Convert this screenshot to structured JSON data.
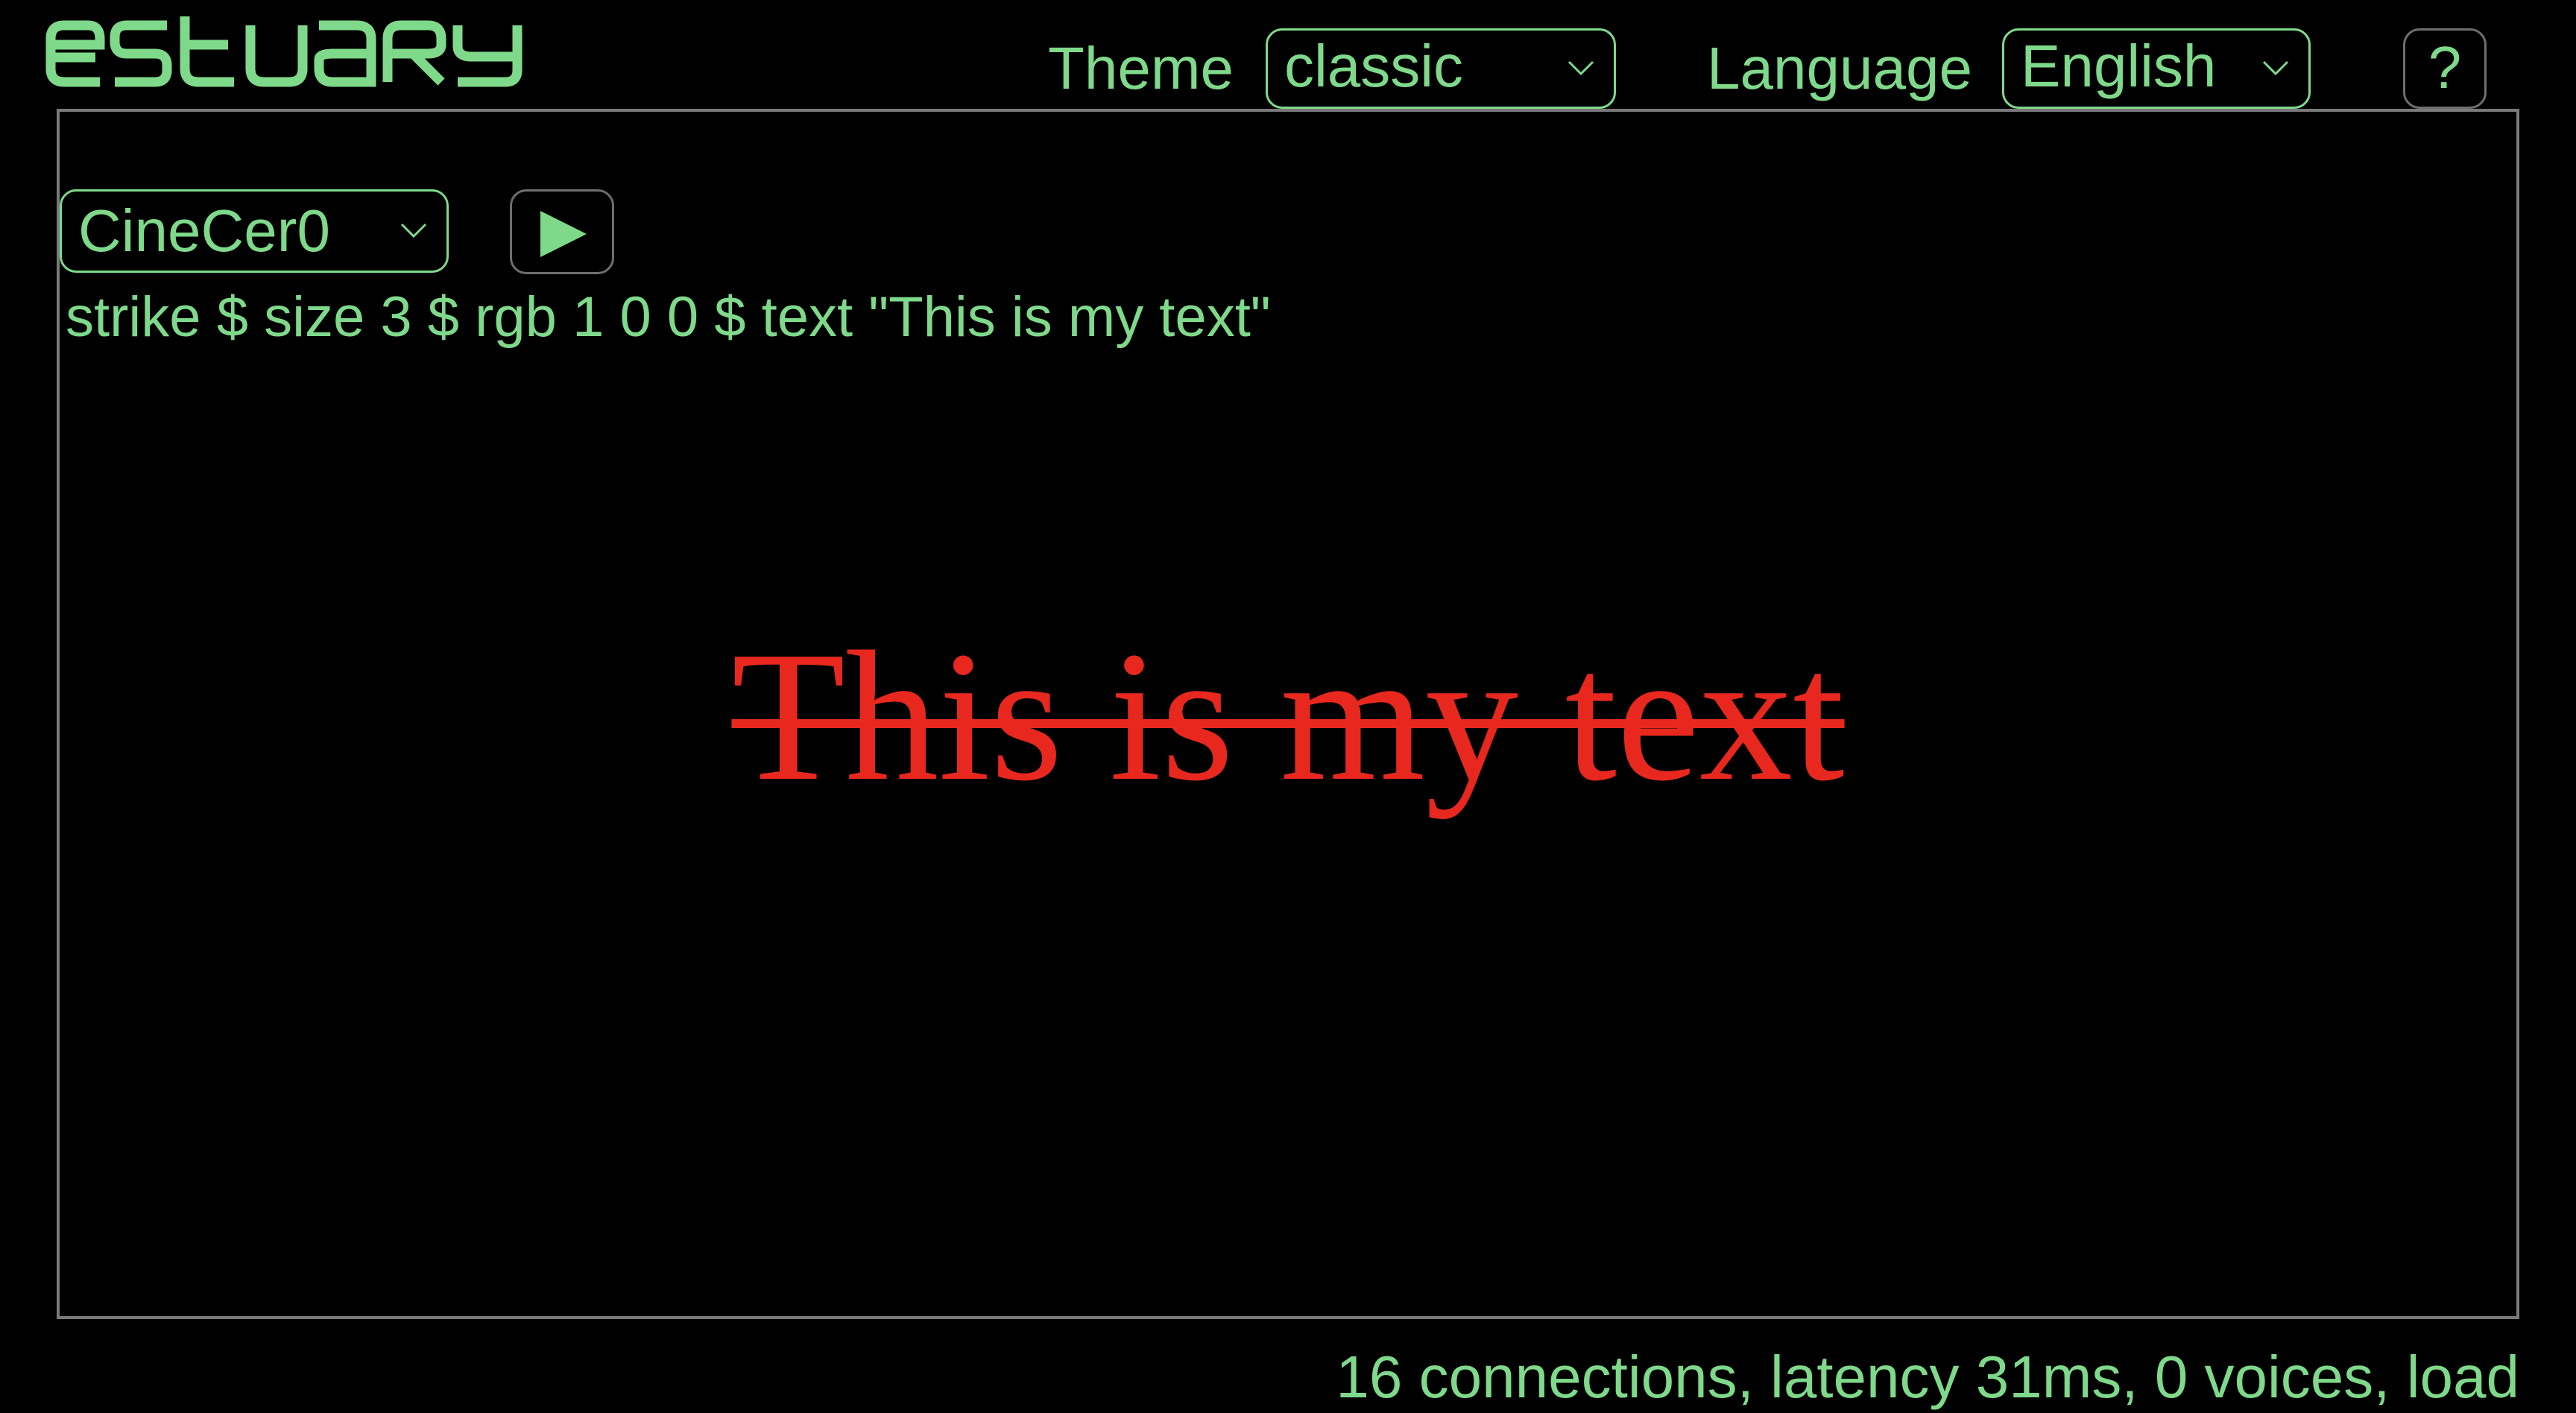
{
  "header": {
    "logo_text": "estuary",
    "theme_label": "Theme",
    "theme_value": "classic",
    "language_label": "Language",
    "language_value": "English",
    "help_label": "?"
  },
  "editor": {
    "language_select_value": "CineCer0",
    "play_icon": "play-icon",
    "code": "strike $ size 3 $ rgb 1 0 0 $ text \"This is my text\""
  },
  "canvas": {
    "rendered_text": "This is my text",
    "text_color": "#e8281e"
  },
  "footer": {
    "status": "16 connections, latency 31ms, 0 voices, load"
  },
  "colors": {
    "accent": "#7fd98a",
    "background": "#000000",
    "border": "#7a7a7a"
  }
}
